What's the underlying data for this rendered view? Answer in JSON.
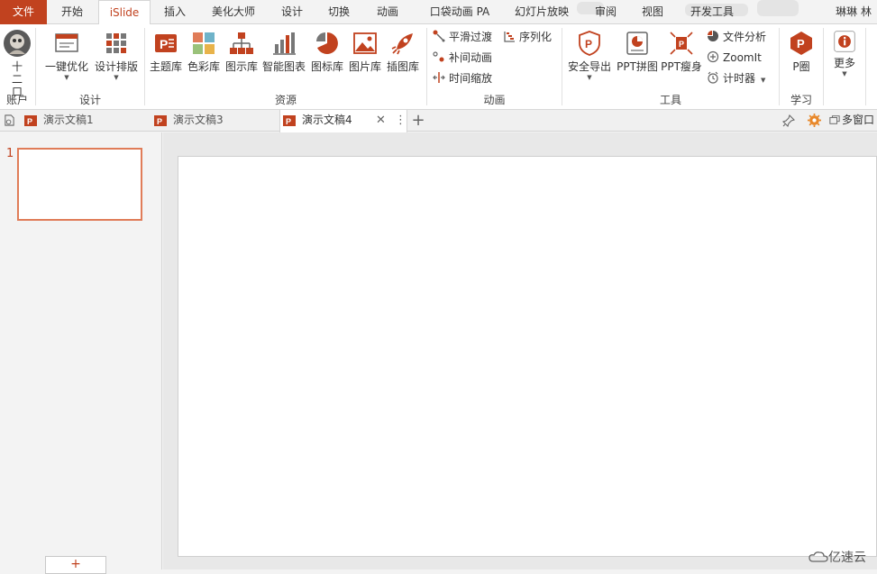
{
  "menu": {
    "file": "文件",
    "tabs": [
      "开始",
      "iSlide",
      "插入",
      "美化大师",
      "设计",
      "切换",
      "动画",
      "口袋动画 PA",
      "幻灯片放映",
      "审阅",
      "视图",
      "开发工具"
    ],
    "active_tab": "iSlide",
    "user": "琳琳 林"
  },
  "ribbon": {
    "account": {
      "name": "十二口",
      "group": "账户"
    },
    "design": {
      "group": "设计",
      "one_click": "一键优化",
      "layout": "设计排版"
    },
    "resources": {
      "group": "资源",
      "items": [
        "主题库",
        "色彩库",
        "图示库",
        "智能图表",
        "图标库",
        "图片库",
        "插图库"
      ]
    },
    "animation": {
      "group": "动画",
      "smooth": "平滑过渡",
      "sequence": "序列化",
      "tween": "补间动画",
      "time_zoom": "时间缩放"
    },
    "tools": {
      "group": "工具",
      "safe_export": "安全导出",
      "ppt_join": "PPT拼图",
      "ppt_slim": "PPT瘦身",
      "file_analysis": "文件分析",
      "zoomit": "ZoomIt",
      "timer": "计时器"
    },
    "learn": {
      "group": "学习",
      "p_circle": "P圈"
    },
    "more": "更多"
  },
  "doc_tabs": {
    "tabs": [
      "演示文稿1",
      "演示文稿3",
      "演示文稿4"
    ],
    "active": "演示文稿4",
    "multi_window": "多窗口"
  },
  "slides": {
    "current_number": "1",
    "add_label": "+"
  },
  "watermark": "亿速云",
  "colors": {
    "accent": "#c1421f",
    "thumb_border": "#e07c58"
  }
}
